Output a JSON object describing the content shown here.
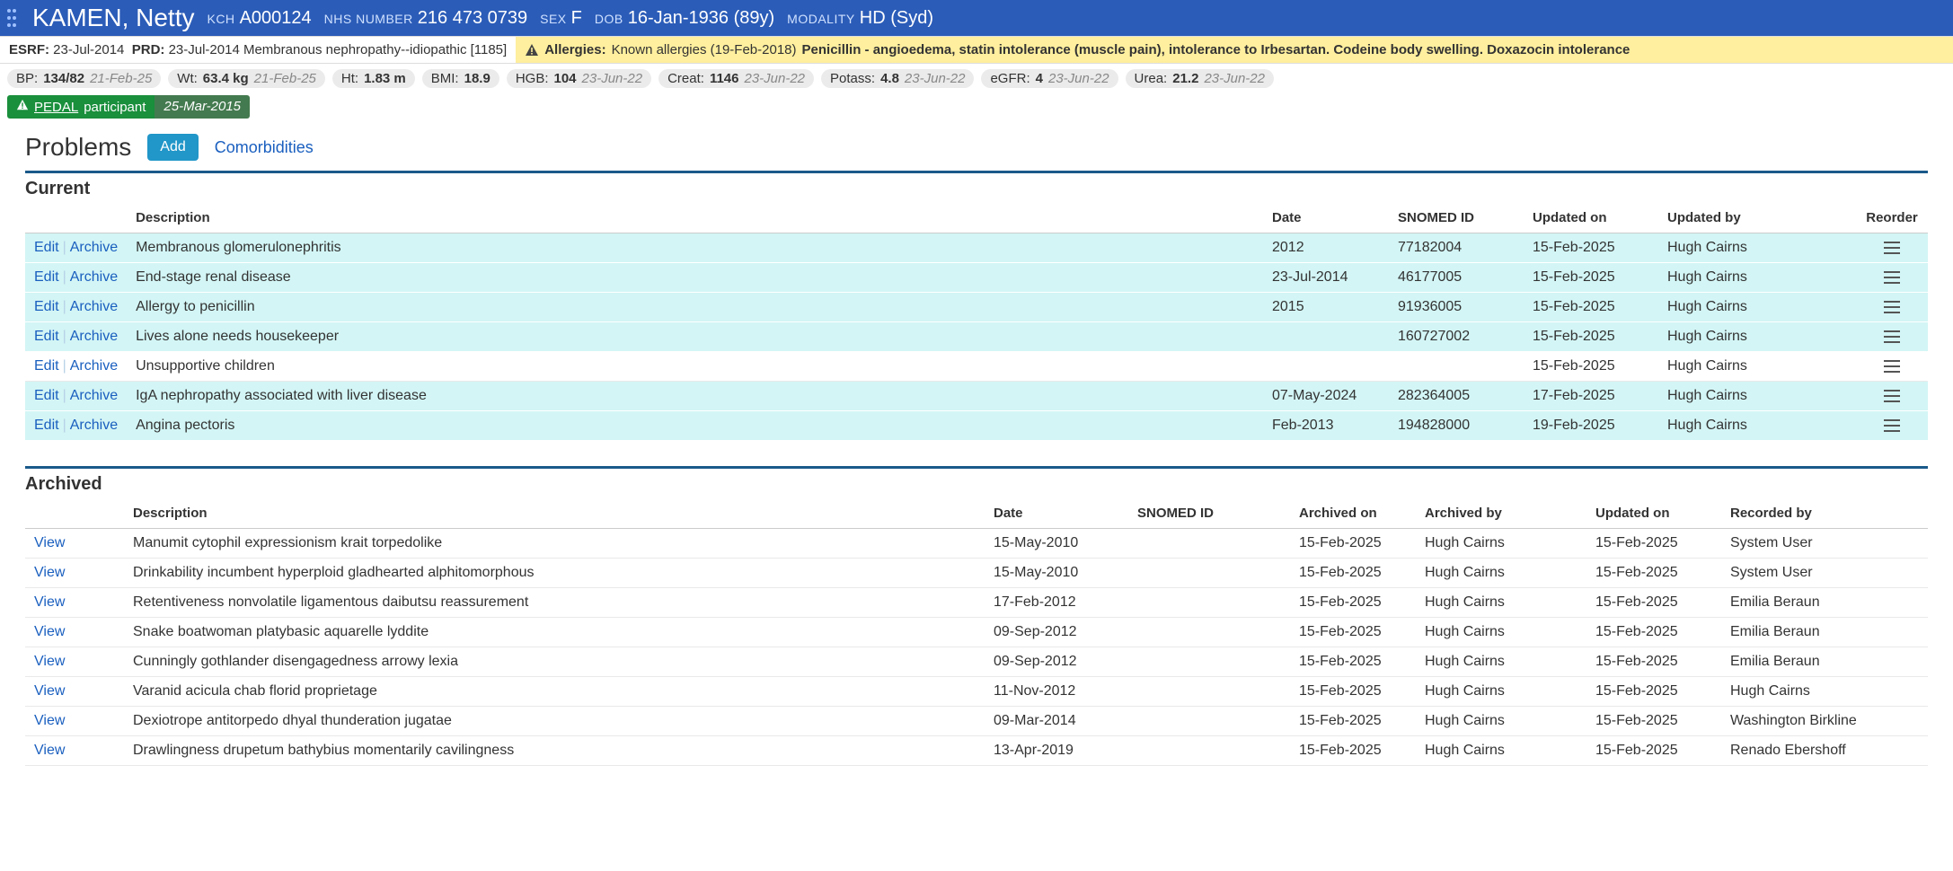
{
  "header": {
    "name": "KAMEN, Netty",
    "kch_label": "KCH",
    "kch_value": "A000124",
    "nhs_label": "NHS NUMBER",
    "nhs_value": "216 473 0739",
    "sex_label": "SEX",
    "sex_value": "F",
    "dob_label": "DOB",
    "dob_value": "16-Jan-1936 (89y)",
    "modality_label": "MODALITY",
    "modality_value": "HD (Syd)"
  },
  "meta": {
    "esrf_label": "ESRF:",
    "esrf_value": "23-Jul-2014",
    "prd_label": "PRD:",
    "prd_value": "23-Jul-2014 Membranous nephropathy--idiopathic [1185]",
    "allergies_label": "Allergies:",
    "allergies_known": "Known allergies (19-Feb-2018)",
    "allergies_text": "Penicillin - angioedema, statin intolerance (muscle pain), intolerance to Irbesartan. Codeine body swelling. Doxazocin intolerance"
  },
  "stats": [
    {
      "label": "BP:",
      "value": "134/82",
      "date": "21-Feb-25"
    },
    {
      "label": "Wt:",
      "value": "63.4 kg",
      "date": "21-Feb-25"
    },
    {
      "label": "Ht:",
      "value": "1.83 m",
      "date": ""
    },
    {
      "label": "BMI:",
      "value": "18.9",
      "date": ""
    },
    {
      "label": "HGB:",
      "value": "104",
      "date": "23-Jun-22"
    },
    {
      "label": "Creat:",
      "value": "1146",
      "date": "23-Jun-22"
    },
    {
      "label": "Potass:",
      "value": "4.8",
      "date": "23-Jun-22"
    },
    {
      "label": "eGFR:",
      "value": "4",
      "date": "23-Jun-22"
    },
    {
      "label": "Urea:",
      "value": "21.2",
      "date": "23-Jun-22"
    }
  ],
  "study": {
    "name": "PEDAL",
    "role": "participant",
    "date": "25-Mar-2015"
  },
  "pageTitle": "Problems",
  "addLabel": "Add",
  "comorbiditiesLabel": "Comorbidities",
  "actions": {
    "edit": "Edit",
    "archive": "Archive",
    "view": "View"
  },
  "currentSection": {
    "title": "Current",
    "headers": {
      "description": "Description",
      "date": "Date",
      "snomed": "SNOMED ID",
      "updatedOn": "Updated on",
      "updatedBy": "Updated by",
      "reorder": "Reorder"
    },
    "rows": [
      {
        "hl": true,
        "desc": "Membranous glomerulonephritis",
        "date": "2012",
        "snomed": "77182004",
        "updatedOn": "15-Feb-2025",
        "updatedBy": "Hugh Cairns"
      },
      {
        "hl": true,
        "desc": "End-stage renal disease",
        "date": "23-Jul-2014",
        "snomed": "46177005",
        "updatedOn": "15-Feb-2025",
        "updatedBy": "Hugh Cairns"
      },
      {
        "hl": true,
        "desc": "Allergy to penicillin",
        "date": "2015",
        "snomed": "91936005",
        "updatedOn": "15-Feb-2025",
        "updatedBy": "Hugh Cairns"
      },
      {
        "hl": true,
        "desc": "Lives alone needs housekeeper",
        "date": "",
        "snomed": "160727002",
        "updatedOn": "15-Feb-2025",
        "updatedBy": "Hugh Cairns"
      },
      {
        "hl": false,
        "desc": "Unsupportive children",
        "date": "",
        "snomed": "",
        "updatedOn": "15-Feb-2025",
        "updatedBy": "Hugh Cairns"
      },
      {
        "hl": true,
        "desc": "IgA nephropathy associated with liver disease",
        "date": "07-May-2024",
        "snomed": "282364005",
        "updatedOn": "17-Feb-2025",
        "updatedBy": "Hugh Cairns"
      },
      {
        "hl": true,
        "desc": "Angina pectoris",
        "date": "Feb-2013",
        "snomed": "194828000",
        "updatedOn": "19-Feb-2025",
        "updatedBy": "Hugh Cairns"
      }
    ]
  },
  "archivedSection": {
    "title": "Archived",
    "headers": {
      "description": "Description",
      "date": "Date",
      "snomed": "SNOMED ID",
      "archivedOn": "Archived on",
      "archivedBy": "Archived by",
      "updatedOn": "Updated on",
      "recordedBy": "Recorded by"
    },
    "rows": [
      {
        "desc": "Manumit cytophil expressionism krait torpedolike",
        "date": "15-May-2010",
        "snomed": "",
        "archivedOn": "15-Feb-2025",
        "archivedBy": "Hugh Cairns",
        "updatedOn": "15-Feb-2025",
        "recordedBy": "System User"
      },
      {
        "desc": "Drinkability incumbent hyperploid gladhearted alphitomorphous",
        "date": "15-May-2010",
        "snomed": "",
        "archivedOn": "15-Feb-2025",
        "archivedBy": "Hugh Cairns",
        "updatedOn": "15-Feb-2025",
        "recordedBy": "System User"
      },
      {
        "desc": "Retentiveness nonvolatile ligamentous daibutsu reassurement",
        "date": "17-Feb-2012",
        "snomed": "",
        "archivedOn": "15-Feb-2025",
        "archivedBy": "Hugh Cairns",
        "updatedOn": "15-Feb-2025",
        "recordedBy": "Emilia Beraun"
      },
      {
        "desc": "Snake boatwoman platybasic aquarelle lyddite",
        "date": "09-Sep-2012",
        "snomed": "",
        "archivedOn": "15-Feb-2025",
        "archivedBy": "Hugh Cairns",
        "updatedOn": "15-Feb-2025",
        "recordedBy": "Emilia Beraun"
      },
      {
        "desc": "Cunningly gothlander disengagedness arrowy lexia",
        "date": "09-Sep-2012",
        "snomed": "",
        "archivedOn": "15-Feb-2025",
        "archivedBy": "Hugh Cairns",
        "updatedOn": "15-Feb-2025",
        "recordedBy": "Emilia Beraun"
      },
      {
        "desc": "Varanid acicula chab florid proprietage",
        "date": "11-Nov-2012",
        "snomed": "",
        "archivedOn": "15-Feb-2025",
        "archivedBy": "Hugh Cairns",
        "updatedOn": "15-Feb-2025",
        "recordedBy": "Hugh Cairns"
      },
      {
        "desc": "Dexiotrope antitorpedo dhyal thunderation jugatae",
        "date": "09-Mar-2014",
        "snomed": "",
        "archivedOn": "15-Feb-2025",
        "archivedBy": "Hugh Cairns",
        "updatedOn": "15-Feb-2025",
        "recordedBy": "Washington Birkline"
      },
      {
        "desc": "Drawlingness drupetum bathybius momentarily cavilingness",
        "date": "13-Apr-2019",
        "snomed": "",
        "archivedOn": "15-Feb-2025",
        "archivedBy": "Hugh Cairns",
        "updatedOn": "15-Feb-2025",
        "recordedBy": "Renado Ebershoff"
      }
    ]
  }
}
